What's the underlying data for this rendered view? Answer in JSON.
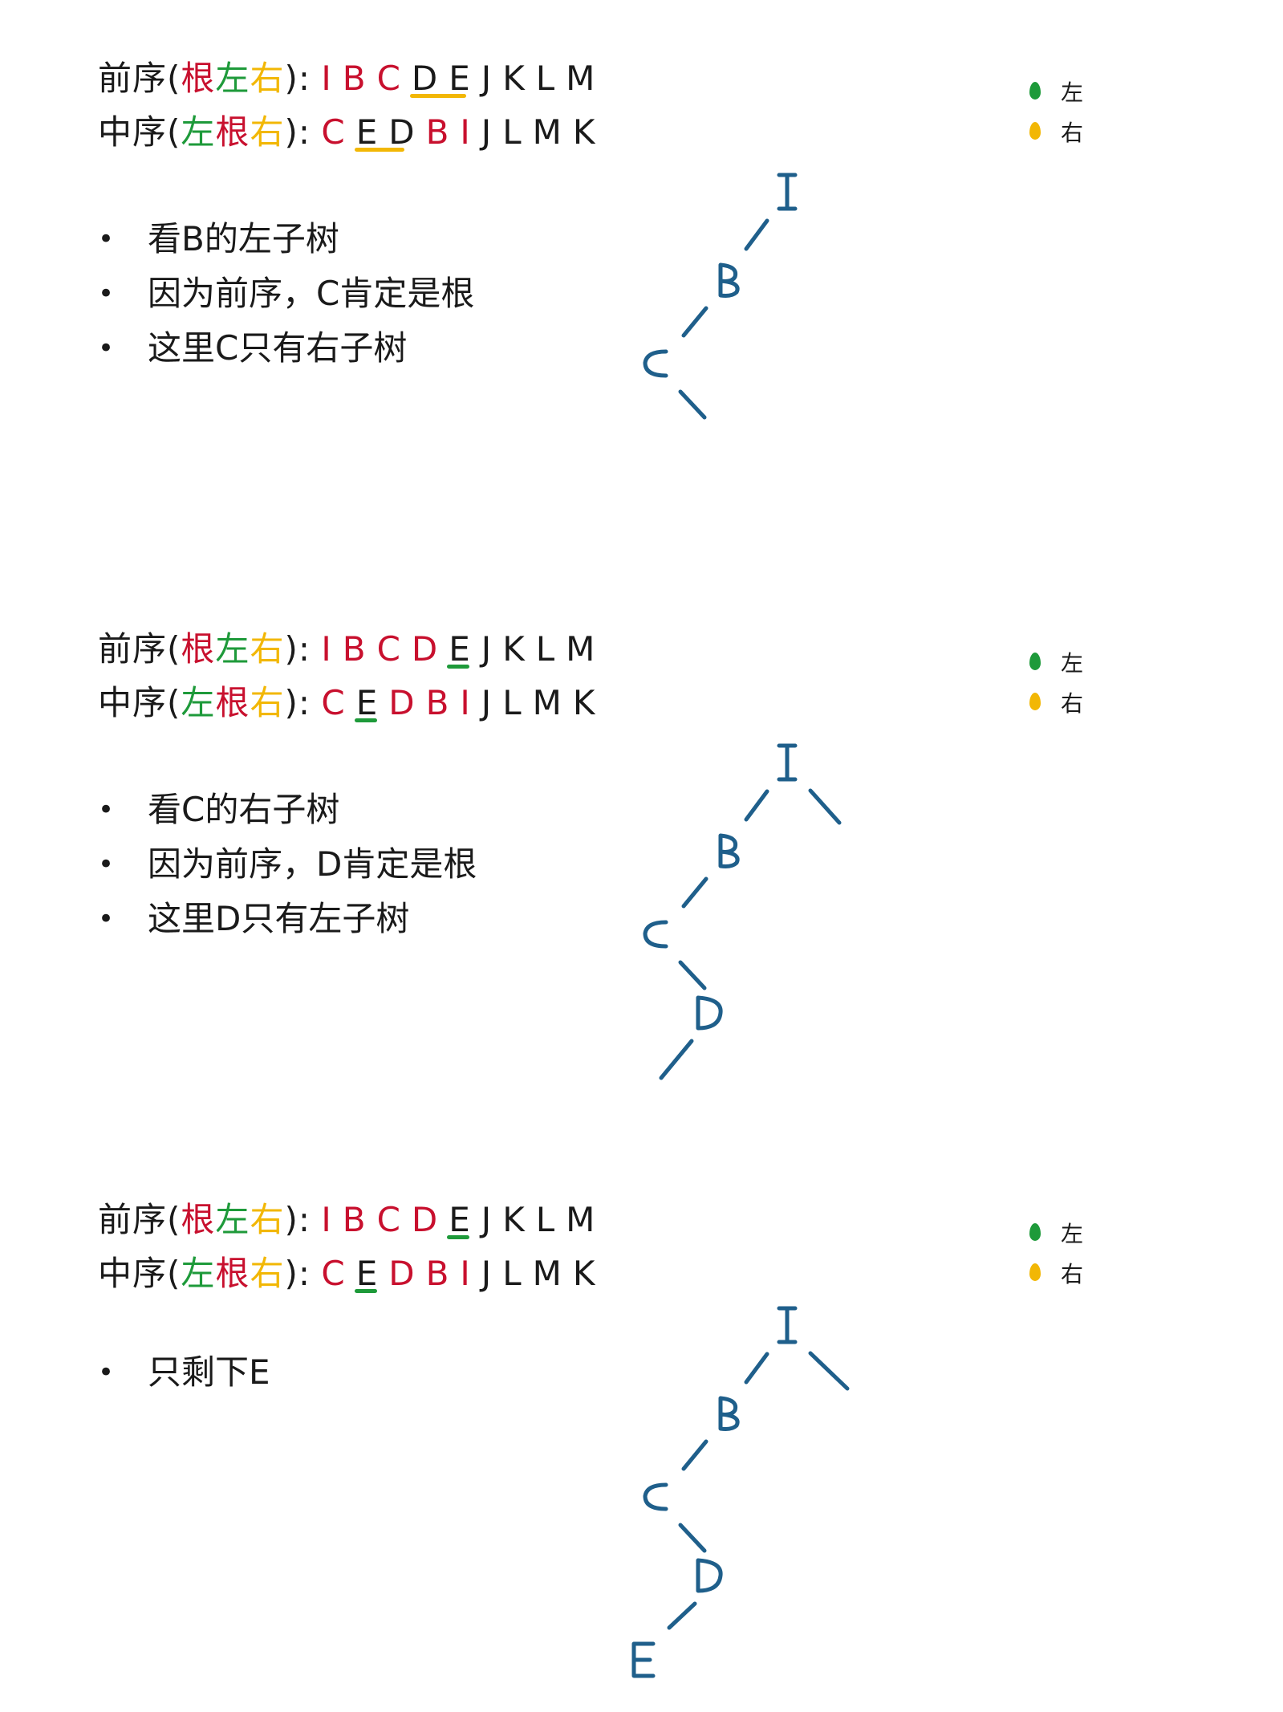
{
  "labels": {
    "preorder": {
      "name": "前序",
      "open": "(",
      "root": "根",
      "left": "左",
      "right": "右",
      "close": "):"
    },
    "inorder": {
      "name": "中序",
      "open": "(",
      "left": "左",
      "root": "根",
      "right": "右",
      "close": "):"
    }
  },
  "legend": {
    "left": "左",
    "right": "右"
  },
  "colors": {
    "root": "#c8102e",
    "left": "#1e9a3a",
    "right": "#f2b705",
    "tree": "#1f5f8b"
  },
  "panels": [
    {
      "preorder": [
        "I",
        "B",
        "C",
        "D",
        "E",
        "J",
        "K",
        "L",
        "M"
      ],
      "inorder": [
        "C",
        "E",
        "D",
        "B",
        "I",
        "J",
        "L",
        "M",
        "K"
      ],
      "bullets": [
        "看B的左子树",
        "因为前序，C肯定是根",
        "这里C只有右子树"
      ],
      "tree_nodes": [
        "I",
        "B",
        "C"
      ]
    },
    {
      "preorder": [
        "I",
        "B",
        "C",
        "D",
        "E",
        "J",
        "K",
        "L",
        "M"
      ],
      "inorder": [
        "C",
        "E",
        "D",
        "B",
        "I",
        "J",
        "L",
        "M",
        "K"
      ],
      "bullets": [
        "看C的右子树",
        "因为前序，D肯定是根",
        "这里D只有左子树"
      ],
      "tree_nodes": [
        "I",
        "B",
        "C",
        "D"
      ]
    },
    {
      "preorder": [
        "I",
        "B",
        "C",
        "D",
        "E",
        "J",
        "K",
        "L",
        "M"
      ],
      "inorder": [
        "C",
        "E",
        "D",
        "B",
        "I",
        "J",
        "L",
        "M",
        "K"
      ],
      "bullets": [
        "只剩下E"
      ],
      "tree_nodes": [
        "I",
        "B",
        "C",
        "D",
        "E"
      ]
    }
  ]
}
